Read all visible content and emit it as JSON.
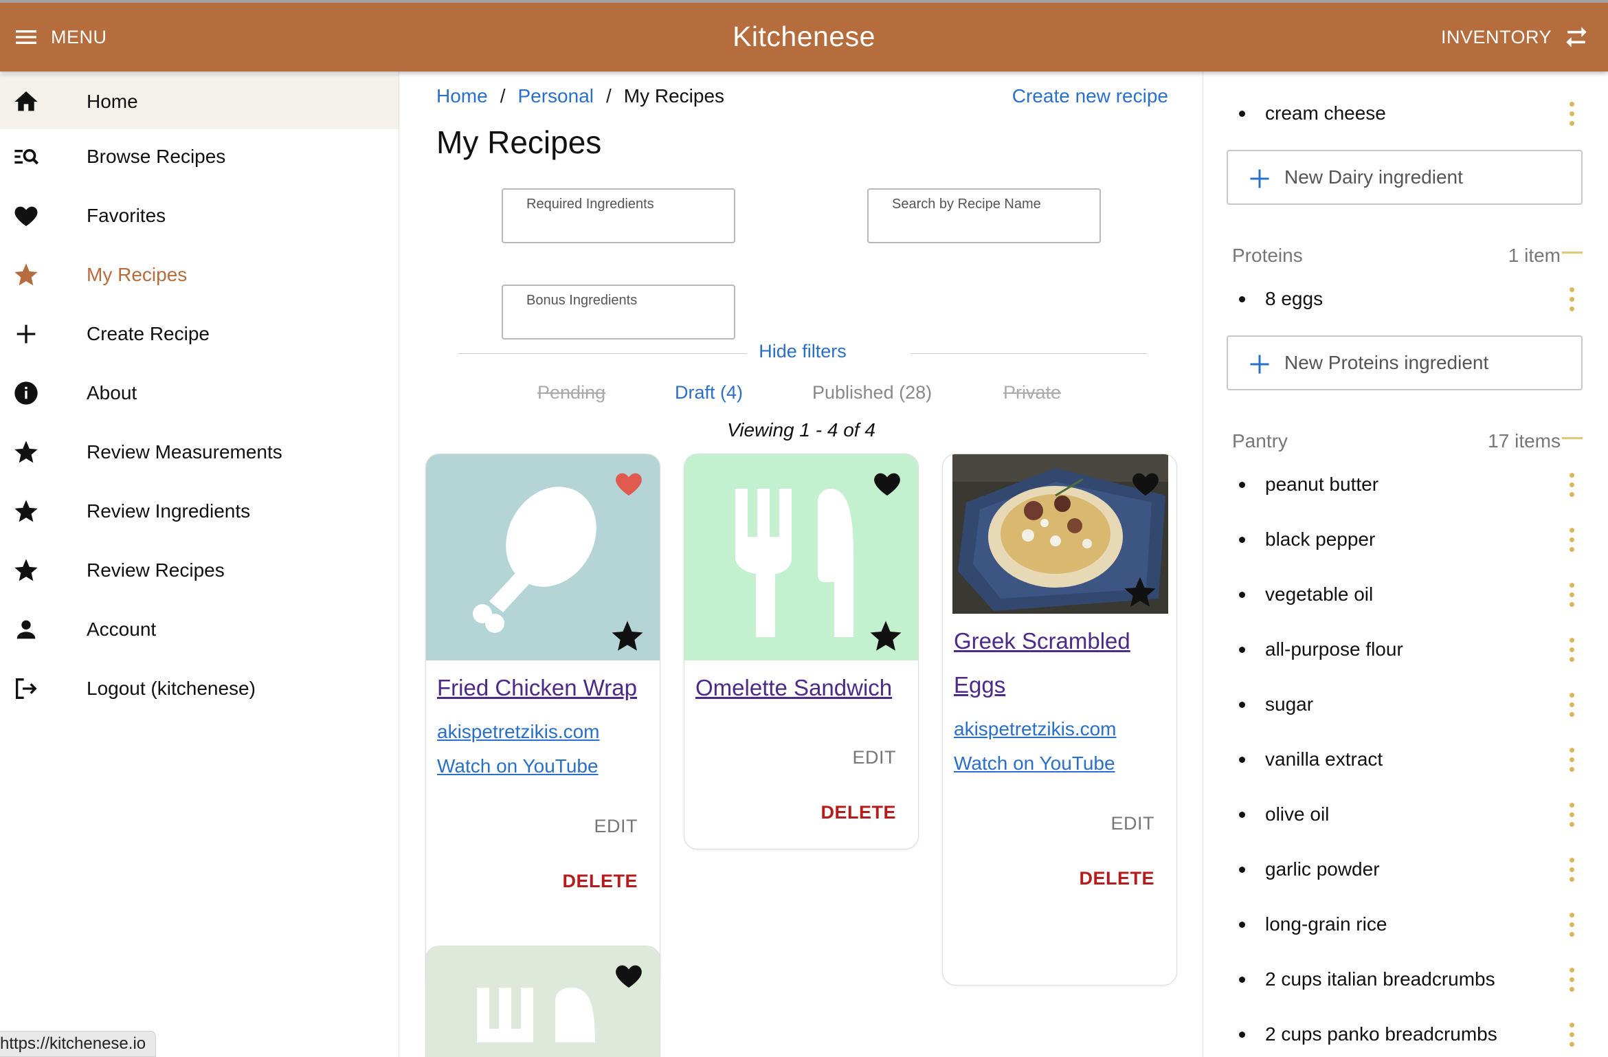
{
  "header": {
    "menu_label": "MENU",
    "app_title": "Kitchenese",
    "inventory_label": "INVENTORY",
    "brand_color": "#b66d3d"
  },
  "sidebar": {
    "items": [
      {
        "label": "Home",
        "icon": "home-icon"
      },
      {
        "label": "Browse Recipes",
        "icon": "search-list-icon"
      },
      {
        "label": "Favorites",
        "icon": "heart-icon"
      },
      {
        "label": "My Recipes",
        "icon": "star-icon"
      },
      {
        "label": "Create Recipe",
        "icon": "plus-icon"
      },
      {
        "label": "About",
        "icon": "info-icon"
      },
      {
        "label": "Review Measurements",
        "icon": "star-icon"
      },
      {
        "label": "Review Ingredients",
        "icon": "star-icon"
      },
      {
        "label": "Review Recipes",
        "icon": "star-icon"
      },
      {
        "label": "Account",
        "icon": "person-icon"
      },
      {
        "label": "Logout (kitchenese)",
        "icon": "logout-icon"
      }
    ]
  },
  "status_url": "https://kitchenese.io",
  "main": {
    "breadcrumb": {
      "home": "Home",
      "personal": "Personal",
      "current": "My Recipes"
    },
    "create_link": "Create new recipe",
    "title": "My Recipes",
    "filters": {
      "required": {
        "label": "Required Ingredients",
        "value": ""
      },
      "search": {
        "label": "Search by Recipe Name",
        "value": ""
      },
      "bonus": {
        "label": "Bonus Ingredients",
        "value": ""
      }
    },
    "hide_filters": "Hide filters",
    "tabs": [
      {
        "label": "Pending",
        "state": "disabled"
      },
      {
        "label": "Draft (4)",
        "state": "selected"
      },
      {
        "label": "Published (28)",
        "state": "normal"
      },
      {
        "label": "Private",
        "state": "disabled"
      }
    ],
    "viewing": "Viewing 1 - 4 of 4",
    "cards": [
      {
        "title": "Fried Chicken Wrap",
        "source": "akispetretzikis.com",
        "video": "Watch on YouTube",
        "edit": "EDIT",
        "delete": "DELETE",
        "favorite": true
      },
      {
        "title": "Omelette Sandwich",
        "edit": "EDIT",
        "delete": "DELETE",
        "favorite": false
      },
      {
        "title_line1": "Greek Scrambled",
        "title_line2": "Eggs",
        "source": "akispetretzikis.com",
        "video": "Watch on YouTube",
        "edit": "EDIT",
        "delete": "DELETE",
        "favorite": false
      },
      {
        "favorite": false
      }
    ],
    "favorite_color": "#e05a4f"
  },
  "inventory": {
    "dairy_items": [
      "cream cheese"
    ],
    "new_dairy": "New Dairy ingredient",
    "proteins": {
      "name": "Proteins",
      "count": "1 item",
      "items": [
        "8 eggs"
      ],
      "new_label": "New Proteins ingredient"
    },
    "pantry": {
      "name": "Pantry",
      "count": "17 items",
      "items": [
        "peanut butter",
        "black pepper",
        "vegetable oil",
        "all-purpose flour",
        "sugar",
        "vanilla extract",
        "olive oil",
        "garlic powder",
        "long-grain rice",
        "2 cups italian breadcrumbs",
        "2 cups panko breadcrumbs"
      ]
    }
  }
}
